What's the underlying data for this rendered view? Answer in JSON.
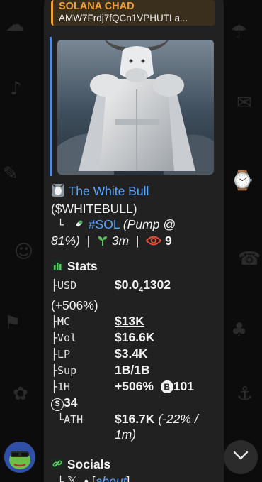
{
  "reply": {
    "title": "SOLANA CHAD",
    "text": "AMW7Frdj7fQCn1VPHUTLa..."
  },
  "token": {
    "name": "The White Bull",
    "ticker": "($WHITEBULL)",
    "chain": "#SOL",
    "pump_prefix": "(Pump @",
    "pump_pct": "81%)",
    "age": "3m",
    "views": "9"
  },
  "stats": {
    "heading": "Stats",
    "usd_label": "USD",
    "usd_value_prefix": "$0.0",
    "usd_value_sub": "4",
    "usd_value_suffix": "1302",
    "usd_change": "(+506%)",
    "mc_label": "MC",
    "mc_value": "$13K",
    "vol_label": "Vol",
    "vol_value": "$16.6K",
    "lp_label": "LP",
    "lp_value": "$3.4K",
    "sup_label": "Sup",
    "sup_value": "1B/1B",
    "h1_label": "1H",
    "h1_value": "+506%",
    "h1_b": "101",
    "h1_s": "34",
    "ath_label": "ATH",
    "ath_value": "$16.7K",
    "ath_change": "(-22% / 1m)"
  },
  "socials": {
    "heading": "Socials",
    "x_glyph": "𝕏",
    "about_label": "about"
  },
  "icons": {
    "bull_icon": "bull-icon",
    "pill_icon": "pill-icon",
    "sprout_icon": "sprout-icon",
    "eye_icon": "eye-icon",
    "chart_icon": "chart-icon",
    "link_icon": "link-icon",
    "chevron_icon": "chevron-down-icon"
  },
  "colors": {
    "accent_orange": "#f0a030",
    "link_blue": "#5aa6ff",
    "bubble_bg": "#212121"
  }
}
